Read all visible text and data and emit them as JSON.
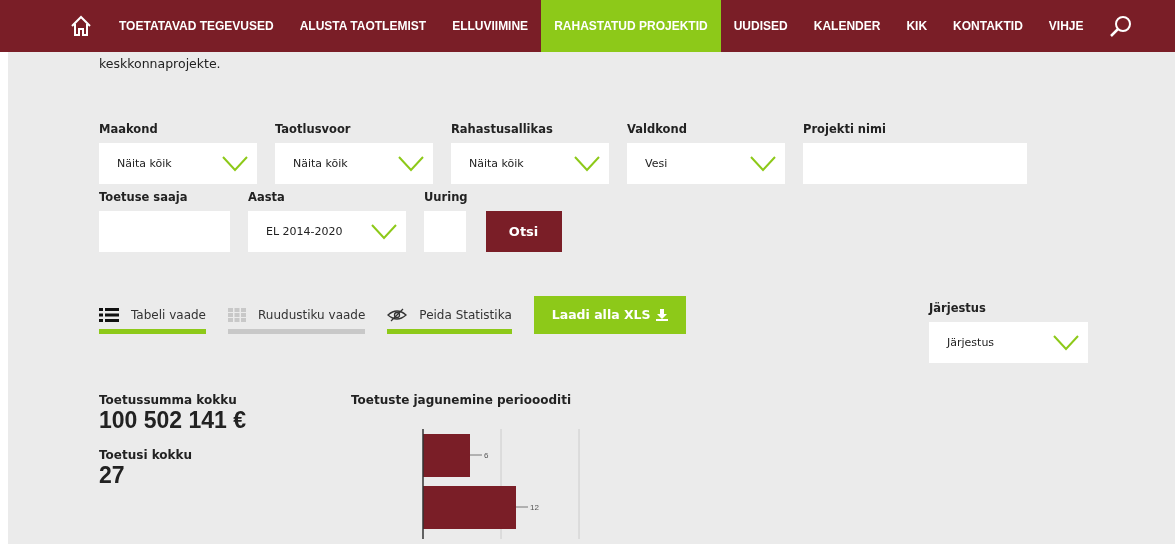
{
  "nav": {
    "items": [
      {
        "label": "TOETATAVAD TEGEVUSED",
        "selected": false
      },
      {
        "label": "ALUSTA TAOTLEMIST",
        "selected": false
      },
      {
        "label": "ELLUVIIMINE",
        "selected": false
      },
      {
        "label": "RAHASTATUD PROJEKTID",
        "selected": true
      },
      {
        "label": "UUDISED",
        "selected": false
      },
      {
        "label": "KALENDER",
        "selected": false
      },
      {
        "label": "KIK",
        "selected": false
      },
      {
        "label": "KONTAKTID",
        "selected": false
      },
      {
        "label": "VIHJE",
        "selected": false
      }
    ]
  },
  "intro": "keskkonnaprojekte.",
  "filters_row_1": [
    {
      "label": "Maakond",
      "kind": "select",
      "value": "Näita kõik"
    },
    {
      "label": "Taotlusvoor",
      "kind": "select",
      "value": "Näita kõik"
    },
    {
      "label": "Rahastusallikas",
      "kind": "select",
      "value": "Näita kõik"
    },
    {
      "label": "Valdkond",
      "kind": "select",
      "value": "Vesi"
    },
    {
      "label": "Projekti nimi",
      "kind": "text"
    }
  ],
  "filters_row_2": [
    {
      "label": "Toetuse saaja",
      "kind": "text"
    },
    {
      "label": "Aasta",
      "kind": "select",
      "value": "EL 2014-2020"
    },
    {
      "label": "Uuring",
      "kind": "small"
    }
  ],
  "search_button": "Otsi",
  "views": [
    {
      "label": "Tabeli vaade",
      "kind": "list",
      "selected": true
    },
    {
      "label": "Ruudustiku vaade",
      "kind": "grid",
      "selected": false
    }
  ],
  "stats_toggle": {
    "label": "Peida Statistika",
    "on": true
  },
  "download_button": "Laadi alla XLS",
  "sort": {
    "label": "Järjestus",
    "value": "Järjestus"
  },
  "totals": [
    {
      "label": "Toetussumma kokku",
      "value": "100 502 141 €"
    },
    {
      "label": "Toetusi kokku",
      "value": "27"
    }
  ],
  "chart": {
    "title": "Toetuste jagunemine perioooditi",
    "bars": [
      {
        "label": "6"
      },
      {
        "label": "12"
      }
    ]
  }
}
